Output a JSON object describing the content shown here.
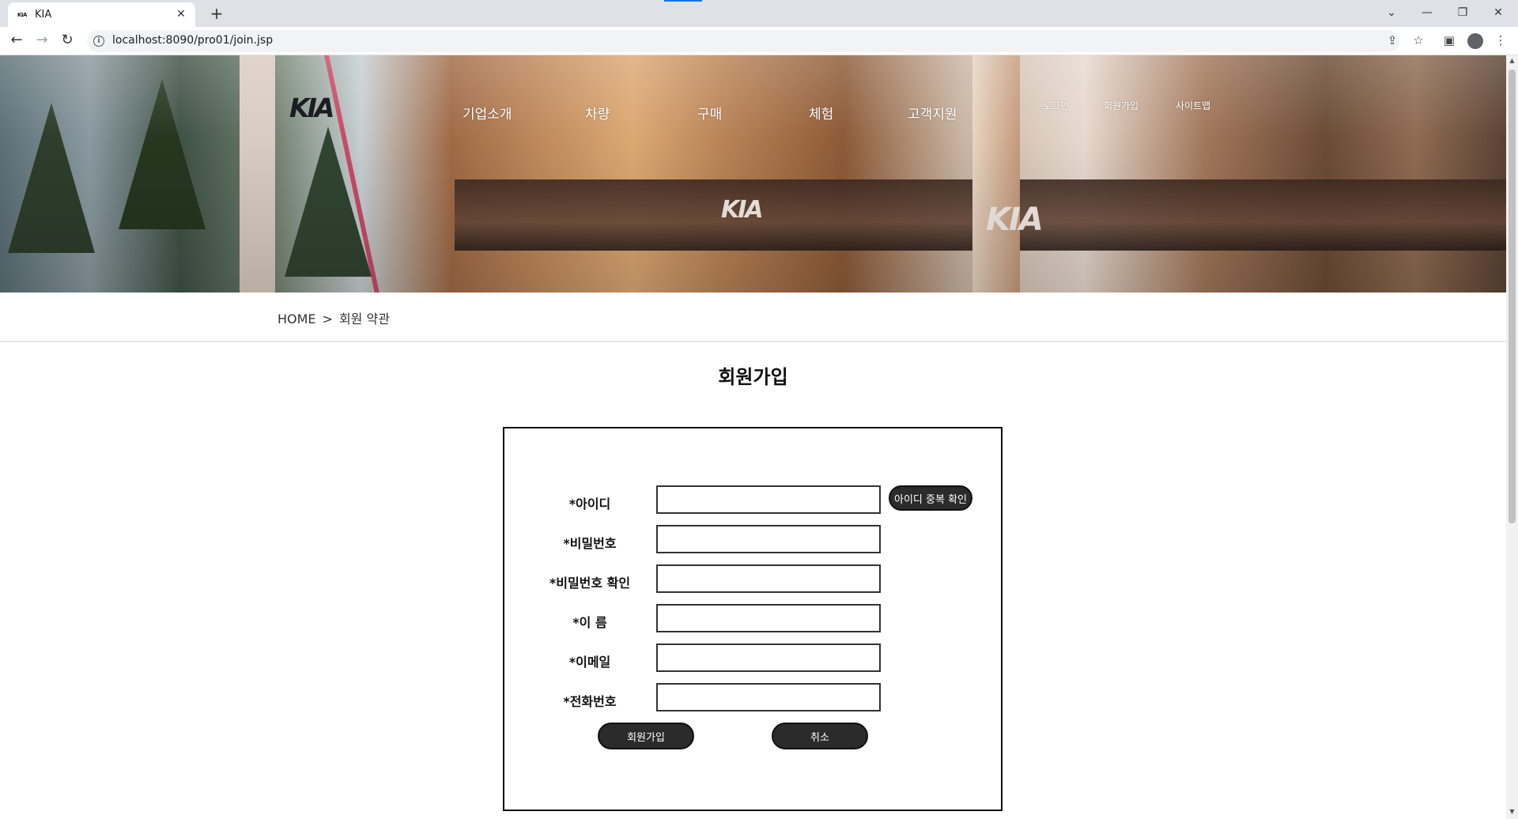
{
  "browser": {
    "tab_title": "KIA",
    "tab_favicon_text": "KIA",
    "url": "localhost:8090/pro01/join.jsp",
    "icons": [
      "back-icon",
      "forward-icon",
      "reload-icon",
      "info-icon",
      "share-icon",
      "star-icon",
      "sidepanel-icon",
      "profile-icon",
      "menu-icon"
    ]
  },
  "header": {
    "logo_text": "KIA",
    "nav": [
      "기업소개",
      "차량",
      "구매",
      "체험",
      "고객지원"
    ],
    "util": [
      "로그인",
      "회원가입",
      "사이트맵"
    ]
  },
  "breadcrumb": {
    "home": "HOME",
    "separator": ">",
    "current": "회원 약관"
  },
  "page_title": "회원가입",
  "form": {
    "fields": [
      {
        "label": "*아이디",
        "value": ""
      },
      {
        "label": "*비밀번호",
        "value": ""
      },
      {
        "label": "*비밀번호 확인",
        "value": ""
      },
      {
        "label": "*이 름",
        "value": ""
      },
      {
        "label": "*이메일",
        "value": ""
      },
      {
        "label": "*전화번호",
        "value": ""
      }
    ],
    "check_id_button": "아이디 중복 확인",
    "submit_button": "회원가입",
    "cancel_button": "취소"
  },
  "colors": {
    "button_bg": "#2b2b2b",
    "hero_accent": "#c94a67"
  }
}
